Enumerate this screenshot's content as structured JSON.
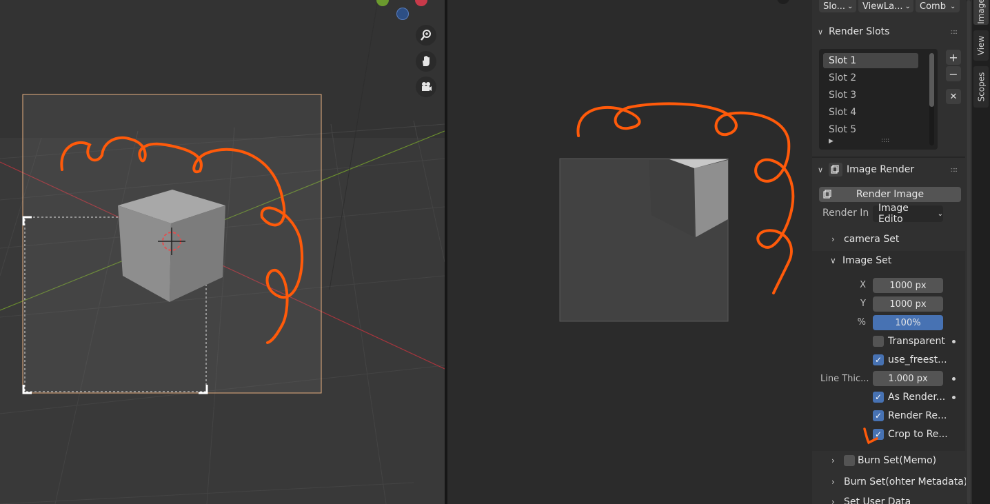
{
  "viewport": {
    "nav": {
      "zoom_icon": "zoom-icon",
      "pan_icon": "hand-icon",
      "camera_icon": "camera-icon"
    },
    "colors": {
      "annotation": "#ff5a0a",
      "x_axis": "#a8353d",
      "y_axis": "#6b8f2e",
      "camera_frame": "#e8b080"
    }
  },
  "sidebar": {
    "top_selects": [
      "Slo...",
      "ViewLa...",
      "Comb"
    ],
    "render_slots": {
      "title": "Render Slots",
      "slots": [
        "Slot 1",
        "Slot 2",
        "Slot 3",
        "Slot 4",
        "Slot 5"
      ],
      "active_index": 0,
      "add_label": "+",
      "remove_label": "−",
      "close_label": "✕"
    },
    "image_render": {
      "title": "Image Render",
      "render_button": "Render Image",
      "render_in_label": "Render In",
      "render_in_value": "Image Edito",
      "camera_set": "camera Set",
      "image_set": "Image Set",
      "x_label": "X",
      "x_value": "1000 px",
      "y_label": "Y",
      "y_value": "1000 px",
      "pct_label": "%",
      "pct_value": "100%",
      "transparent": "Transparent",
      "use_freestyle": "use_freest...",
      "line_thickness_label": "Line Thic...",
      "line_thickness_value": "1.000 px",
      "as_render": "As Render...",
      "render_region": "Render Re...",
      "crop_to_region": "Crop to Re...",
      "burn_set_memo": "Burn Set(Memo)",
      "burn_set_other": "Burn Set(ohter Metadata)",
      "set_user_data": "Set User Data"
    }
  },
  "tabs": [
    "Image",
    "View",
    "Scopes"
  ]
}
